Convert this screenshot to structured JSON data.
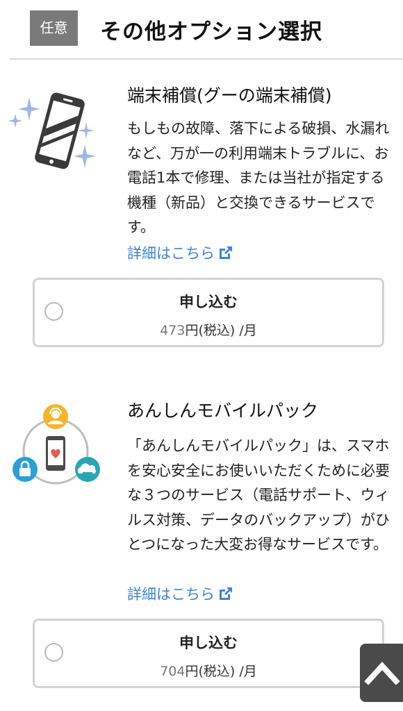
{
  "header": {
    "badge": "任意",
    "title": "その他オプション選択"
  },
  "services": [
    {
      "title": "端末補償(グーの端末補償)",
      "description": "もしもの故障、落下による破損、水漏れなど、万が一の利用端末トラブルに、お電話1本で修理、または当社が指定する機種（新品）と交換できるサービスです。",
      "detail_link": "詳細はこちら",
      "apply_label": "申し込む",
      "price": "473",
      "price_suffix": "円(税込) /月"
    },
    {
      "title": "あんしんモバイルパック",
      "description": "「あんしんモバイルパック」は、スマホを安心安全にお使いいただくために必要な３つのサービス（電話サポート、ウィルス対策、データのバックアップ）がひとつになった大変お得なサービスです。",
      "detail_link": "詳細はこちら",
      "apply_label": "申し込む",
      "price": "704",
      "price_suffix": "円(税込) /月"
    }
  ],
  "icons": {
    "external_link": "external-link-icon",
    "radio": "radio-unchecked",
    "scroll_top": "chevron-up-icon"
  },
  "colors": {
    "link": "#3b85d8",
    "badge_bg": "#7a7a7a",
    "scroll_button_bg": "#4a4a4a",
    "pack_orange": "#f5b52a",
    "pack_blue": "#2b9fd6",
    "pack_teal": "#27a6b5",
    "heart": "#e85a5a"
  }
}
